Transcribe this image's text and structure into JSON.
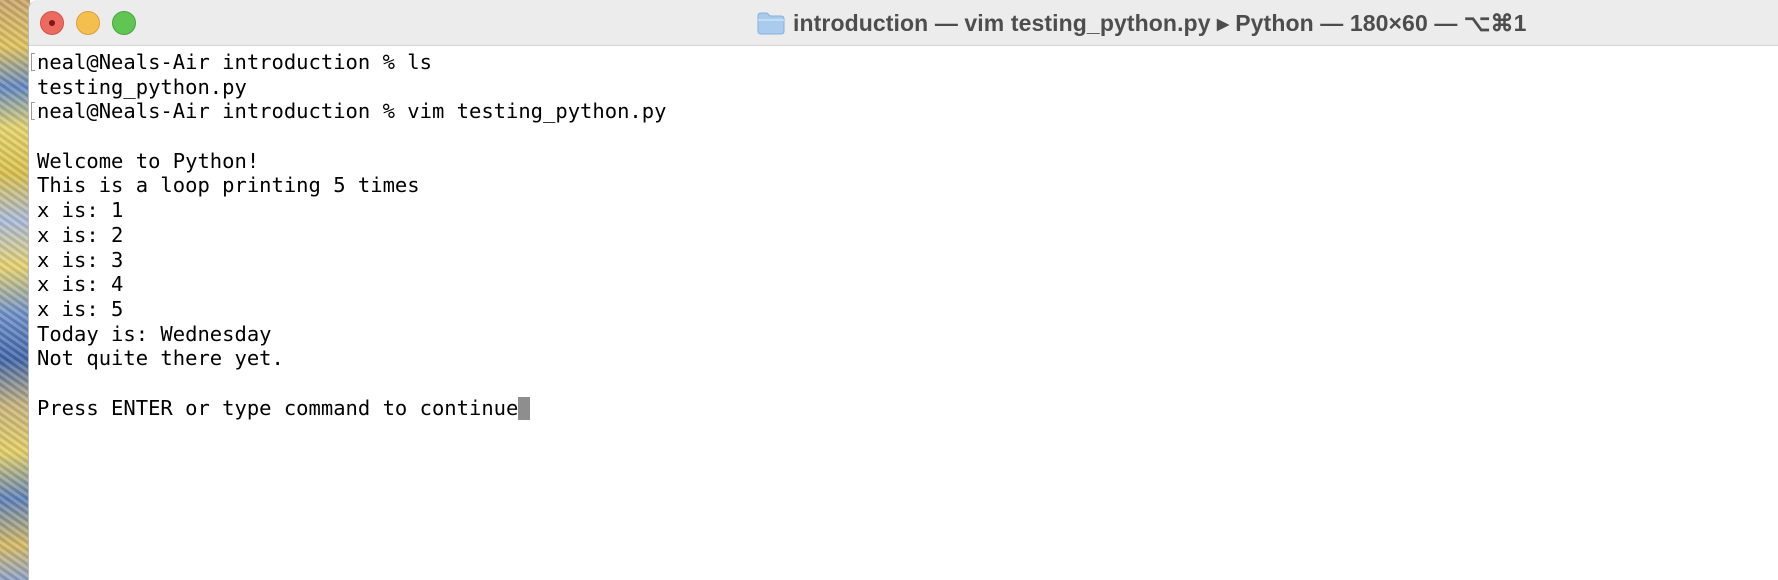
{
  "window": {
    "title": "introduction — vim testing_python.py ▸ Python — 180×60 — ⌥⌘1",
    "folder_icon": "folder-icon",
    "traffic_lights": {
      "close_color": "#ed6a5e",
      "minimize_color": "#f5bf4f",
      "zoom_color": "#61c554"
    }
  },
  "terminal": {
    "lines": [
      {
        "text": "neal@Neals-Air introduction % ls",
        "prompt": true
      },
      {
        "text": "testing_python.py",
        "prompt": false
      },
      {
        "text": "neal@Neals-Air introduction % vim testing_python.py",
        "prompt": true
      },
      {
        "text": "",
        "prompt": false
      },
      {
        "text": "Welcome to Python!",
        "prompt": false
      },
      {
        "text": "This is a loop printing 5 times",
        "prompt": false
      },
      {
        "text": "x is: 1",
        "prompt": false
      },
      {
        "text": "x is: 2",
        "prompt": false
      },
      {
        "text": "x is: 3",
        "prompt": false
      },
      {
        "text": "x is: 4",
        "prompt": false
      },
      {
        "text": "x is: 5",
        "prompt": false
      },
      {
        "text": "Today is: Wednesday",
        "prompt": false
      },
      {
        "text": "Not quite there yet.",
        "prompt": false
      },
      {
        "text": "",
        "prompt": false
      },
      {
        "text": "Press ENTER or type command to continue",
        "prompt": false,
        "cursor": true
      }
    ]
  }
}
